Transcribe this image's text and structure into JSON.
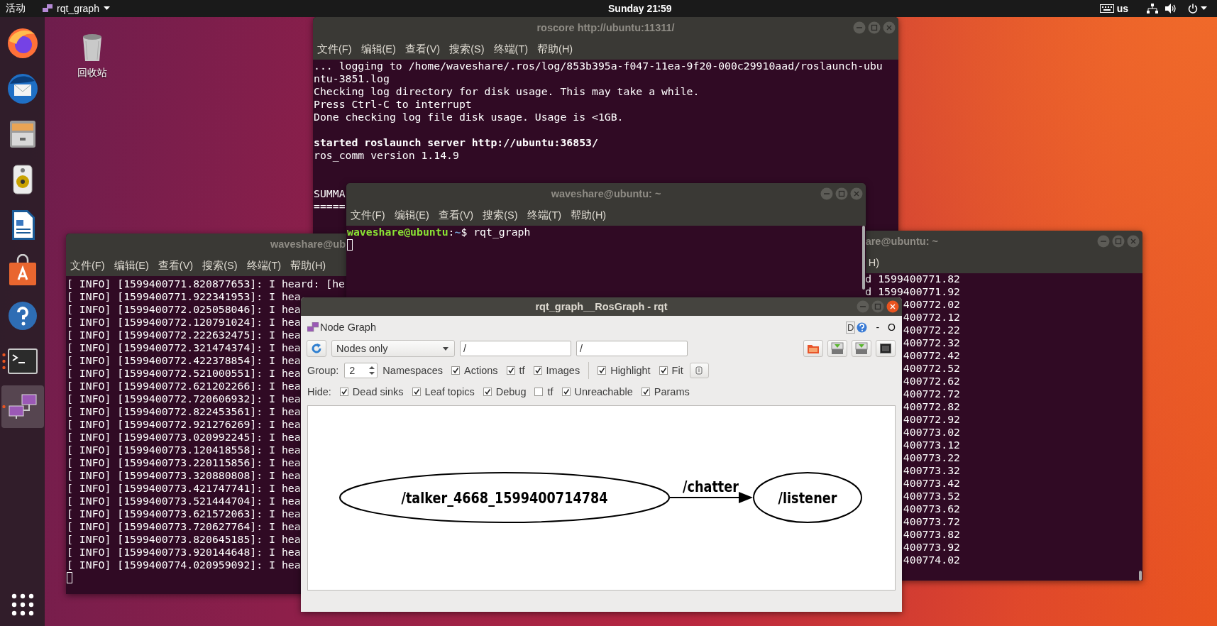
{
  "top_bar": {
    "activities": "活动",
    "app_menu": "rqt_graph",
    "clock": "Sunday 21∶59",
    "keyboard_layout": "us"
  },
  "dock": [
    {
      "kind": "browser",
      "active": false,
      "running": false
    },
    {
      "kind": "mail",
      "active": false,
      "running": false
    },
    {
      "kind": "files",
      "active": false,
      "running": false
    },
    {
      "kind": "music",
      "active": false,
      "running": false
    },
    {
      "kind": "writer",
      "active": false,
      "running": false
    },
    {
      "kind": "software",
      "active": false,
      "running": false
    },
    {
      "kind": "help",
      "active": false,
      "running": false
    },
    {
      "kind": "terminal",
      "active": false,
      "running": true,
      "multiple_windows": true
    },
    {
      "kind": "rqt",
      "active": true,
      "running": true,
      "multiple_windows": false
    }
  ],
  "desktop_icons": [
    {
      "label": "回收站"
    }
  ],
  "roscore_terminal": {
    "title": "roscore http://ubuntu:11311/",
    "active": false,
    "menu": [
      "文件(F)",
      "编辑(E)",
      "查看(V)",
      "搜索(S)",
      "终端(T)",
      "帮助(H)"
    ],
    "lines": [
      {
        "kind": "plain",
        "text": "... logging to /home/waveshare/.ros/log/853b395a-f047-11ea-9f20-000c29910aad/roslaunch-ubu"
      },
      {
        "kind": "plain",
        "text": "ntu-3851.log"
      },
      {
        "kind": "plain",
        "text": "Checking log directory for disk usage. This may take a while."
      },
      {
        "kind": "plain",
        "text": "Press Ctrl-C to interrupt"
      },
      {
        "kind": "plain",
        "text": "Done checking log file disk usage. Usage is <1GB."
      },
      {
        "kind": "blank"
      },
      {
        "kind": "bold",
        "text": "started roslaunch server http://ubuntu:36853/"
      },
      {
        "kind": "plain",
        "text": "ros_comm version 1.14.9"
      },
      {
        "kind": "blank"
      },
      {
        "kind": "blank"
      },
      {
        "kind": "plain",
        "text": "SUMMA"
      },
      {
        "kind": "plain",
        "text": "====="
      }
    ]
  },
  "left_terminal": {
    "title": "waveshare@ub",
    "menu": [
      "文件(F)",
      "编辑(E)",
      "查看(V)",
      "搜索(S)",
      "终端(T)",
      "帮助(H)"
    ],
    "lines": [
      "[ INFO] [1599400771.820877653]: I heard: [he",
      "[ INFO] [1599400771.922341953]: I hea",
      "[ INFO] [1599400772.025058046]: I hea",
      "[ INFO] [1599400772.120791024]: I hea",
      "[ INFO] [1599400772.222632475]: I hea",
      "[ INFO] [1599400772.321474374]: I hea",
      "[ INFO] [1599400772.422378854]: I hea",
      "[ INFO] [1599400772.521000551]: I hea",
      "[ INFO] [1599400772.621202266]: I hea",
      "[ INFO] [1599400772.720606932]: I hea",
      "[ INFO] [1599400772.822453561]: I hea",
      "[ INFO] [1599400772.921276269]: I hea",
      "[ INFO] [1599400773.020992245]: I hea",
      "[ INFO] [1599400773.120418558]: I hea",
      "[ INFO] [1599400773.220115856]: I hea",
      "[ INFO] [1599400773.320880808]: I hea",
      "[ INFO] [1599400773.421747741]: I hea",
      "[ INFO] [1599400773.521444704]: I hea",
      "[ INFO] [1599400773.621572063]: I hea",
      "[ INFO] [1599400773.720627764]: I hea",
      "[ INFO] [1599400773.820645185]: I hea",
      "[ INFO] [1599400773.920144648]: I hea",
      "[ INFO] [1599400774.020959092]: I hea"
    ]
  },
  "right_terminal": {
    "title": "are@ubuntu: ~",
    "active": false,
    "menu": [
      "H)"
    ],
    "lines": [
      "d 1599400771.82",
      "d 1599400771.92",
      "400772.02",
      "400772.12",
      "400772.22",
      "400772.32",
      "400772.42",
      "400772.52",
      "400772.62",
      "400772.72",
      "400772.82",
      "400772.92",
      "400773.02",
      "400773.12",
      "400773.22",
      "400773.32",
      "400773.42",
      "400773.52",
      "400773.62",
      "400773.72",
      "400773.82",
      "400773.92",
      "400774.02"
    ]
  },
  "shell_terminal": {
    "title": "waveshare@ubuntu: ~",
    "active": false,
    "menu": [
      "文件(F)",
      "编辑(E)",
      "查看(V)",
      "搜索(S)",
      "终端(T)",
      "帮助(H)"
    ],
    "prompt": [
      {
        "kind": "user",
        "text": "waveshare@ubuntu"
      },
      {
        "kind": "plain",
        "text": ":"
      },
      {
        "kind": "path",
        "text": "~"
      },
      {
        "kind": "plain",
        "text": "$ rqt_graph"
      }
    ]
  },
  "rqt_window": {
    "title": "rqt_graph__RosGraph - rqt",
    "active": true,
    "plugin_title": "Node Graph",
    "dock_buttons": [
      "D",
      "-",
      "O"
    ],
    "graph_type": "Nodes only",
    "filters": [
      "/",
      "/"
    ],
    "group_label": "Group:",
    "group_value": "2",
    "namespaces_label": "Namespaces",
    "options": [
      {
        "label": "Actions",
        "checked": true
      },
      {
        "label": "tf",
        "checked": true
      },
      {
        "label": "Images",
        "checked": true
      }
    ],
    "view_options": [
      {
        "label": "Highlight",
        "checked": true
      },
      {
        "label": "Fit",
        "checked": true
      }
    ],
    "hide_label": "Hide:",
    "hide_options": [
      {
        "label": "Dead sinks",
        "checked": true
      },
      {
        "label": "Leaf topics",
        "checked": true
      },
      {
        "label": "Debug",
        "checked": true
      },
      {
        "label": "tf",
        "checked": false
      },
      {
        "label": "Unreachable",
        "checked": true
      },
      {
        "label": "Params",
        "checked": true
      }
    ],
    "graph": {
      "nodes": [
        {
          "label": "/talker_4668_1599400714784"
        },
        {
          "label": "/listener"
        }
      ],
      "edges": [
        {
          "label": "/chatter"
        }
      ]
    }
  }
}
